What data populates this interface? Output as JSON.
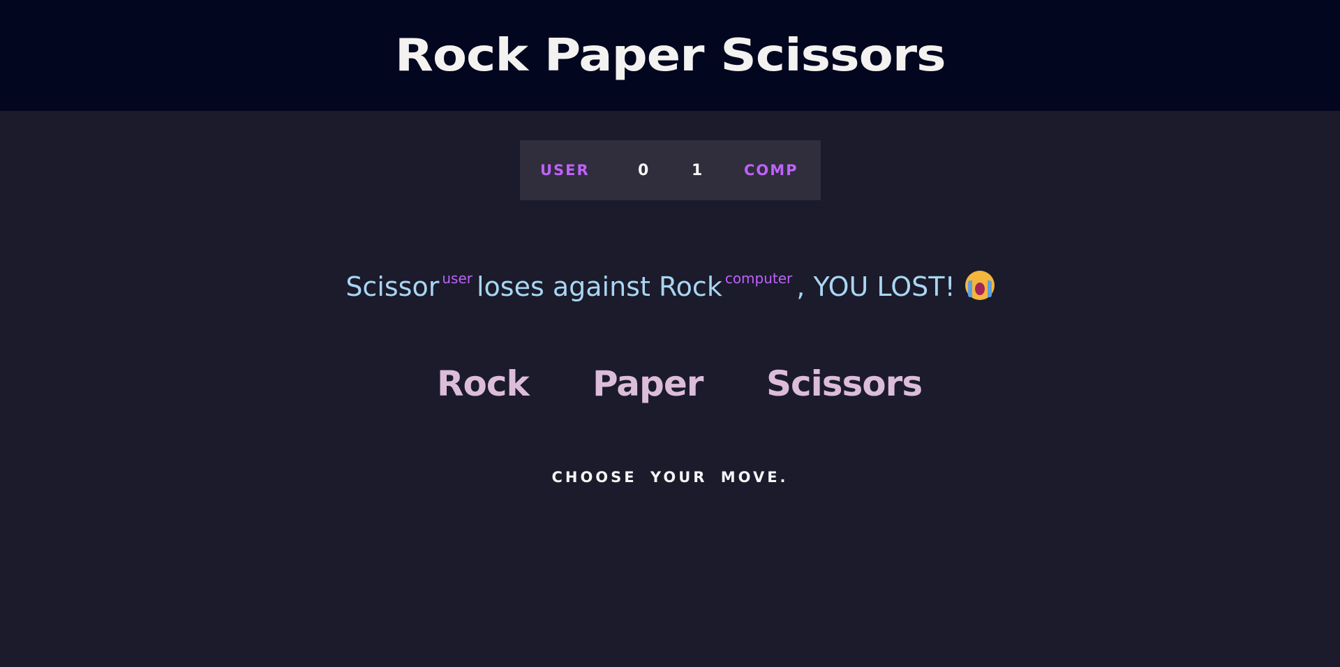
{
  "header": {
    "title": "Rock Paper Scissors"
  },
  "scoreboard": {
    "user_label": "USER",
    "user_score": "0",
    "comp_score": "1",
    "comp_label": "COMP"
  },
  "result": {
    "user_choice": "Scissor",
    "user_tag": "user",
    "verb": "loses against",
    "computer_choice": "Rock",
    "computer_tag": "computer",
    "outcome": ", YOU LOST!",
    "emoji_icon": "loudly-crying-face-icon"
  },
  "choices": [
    {
      "label": "Rock"
    },
    {
      "label": "Paper"
    },
    {
      "label": "Scissors"
    }
  ],
  "prompt": {
    "text": "CHOOSE YOUR MOVE."
  },
  "colors": {
    "header_bg": "#03061f",
    "page_bg": "#1b1b2c",
    "scoreboard_bg": "#302d3d",
    "accent_purple": "#bf62fa",
    "result_text": "#a9d6f2",
    "choice_text": "#dcbdd9"
  }
}
